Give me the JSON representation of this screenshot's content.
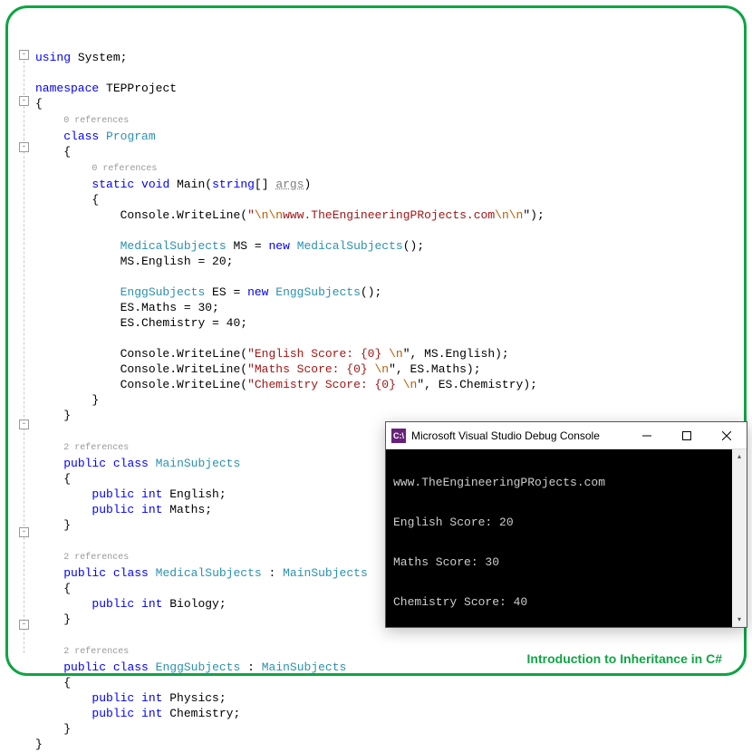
{
  "code": {
    "using": "using",
    "system": "System",
    "namespace": "namespace",
    "ns_name": "TEPProject",
    "ref0": "0 references",
    "ref2": "2 references",
    "class": "class",
    "Program": "Program",
    "static": "static",
    "void": "void",
    "Main": "Main",
    "string_arr": "string",
    "args": "args",
    "Console": "Console",
    "WriteLine": ".WriteLine(",
    "esc_nn": "\\n\\n",
    "url": "www.TheEngineeringPRojects.com",
    "close_str": "\");",
    "MedicalSubjects": "MedicalSubjects",
    "MS_decl": " MS = ",
    "new": "new",
    "paren_close": "();",
    "MS_English": "MS.English = 20;",
    "EnggSubjects": "EnggSubjects",
    "ES_decl": " ES = ",
    "ES_Maths": "ES.Maths = 30;",
    "ES_Chem": "ES.Chemistry = 40;",
    "str_english": "\"English Score: {0} ",
    "esc_n": "\\n",
    "arg_MS_English": "\", MS.English);",
    "str_maths": "\"Maths Score: {0} ",
    "arg_ES_Maths": "\", ES.Maths);",
    "str_chem": "\"Chemistry Score: {0} ",
    "arg_ES_Chem": "\", ES.Chemistry);",
    "public": "public",
    "MainSubjects": "MainSubjects",
    "int": "int",
    "English": " English;",
    "Maths": " Maths;",
    "colon_main": ": ",
    "Biology": " Biology;",
    "Physics": " Physics;",
    "Chemistry": " Chemistry;"
  },
  "console": {
    "title": "Microsoft Visual Studio Debug Console",
    "icon_text": "C:\\",
    "lines": {
      "l0": "",
      "l1": "www.TheEngineeringPRojects.com",
      "l2": "",
      "l3": "English Score: 20",
      "l4": "",
      "l5": "Maths Score: 30",
      "l6": "",
      "l7": "Chemistry Score: 40"
    }
  },
  "footer": "Introduction to Inheritance in C#",
  "colors": {
    "border": "#0fa444",
    "keyword": "#0000ff",
    "type": "#2b91af",
    "string": "#a31515"
  }
}
